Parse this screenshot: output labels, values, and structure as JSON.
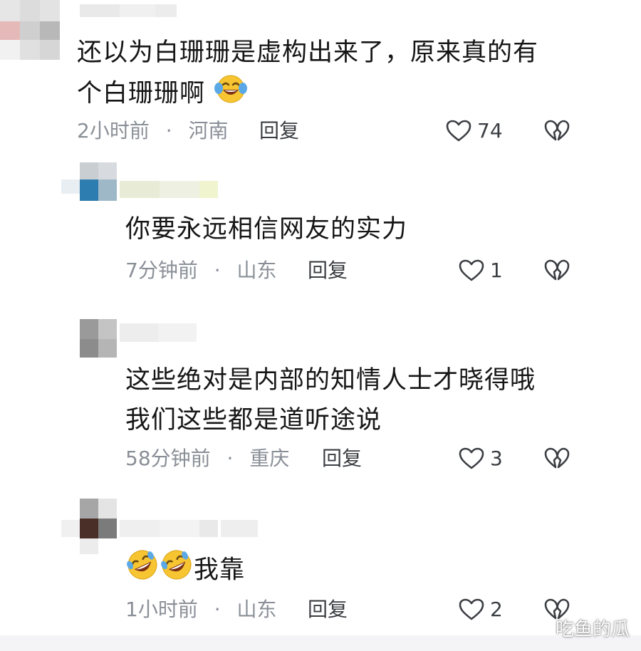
{
  "comments": [
    {
      "text_lines": [
        "还以为白珊珊是虚构出来了，原来真的有",
        "个白珊珊啊"
      ],
      "time": "2小时前",
      "separator": "·",
      "location": "河南",
      "reply_label": "回复",
      "like_count": "74"
    },
    {
      "text_lines": [
        "你要永远相信网友的实力"
      ],
      "time": "7分钟前",
      "separator": "·",
      "location": "山东",
      "reply_label": "回复",
      "like_count": "1"
    },
    {
      "text_lines": [
        "这些绝对是内部的知情人士才晓得哦",
        "我们这些都是道听途说"
      ],
      "time": "58分钟前",
      "separator": "·",
      "location": "重庆",
      "reply_label": "回复",
      "like_count": "3"
    },
    {
      "text_lines": [
        "我靠"
      ],
      "time": "1小时前",
      "separator": "·",
      "location": "山东",
      "reply_label": "回复",
      "like_count": "2"
    }
  ],
  "icons": {
    "like": "heart-outline-icon",
    "dislike": "broken-heart-icon",
    "emoji_tears": "laughing-tears-emoji",
    "emoji_rofl": "rolling-laughing-emoji"
  },
  "watermark": "吃鱼的瓜",
  "colors": {
    "meta": "#8a8f97",
    "text": "#161616",
    "icon": "#3a3d42",
    "emoji": "#f7c531"
  }
}
